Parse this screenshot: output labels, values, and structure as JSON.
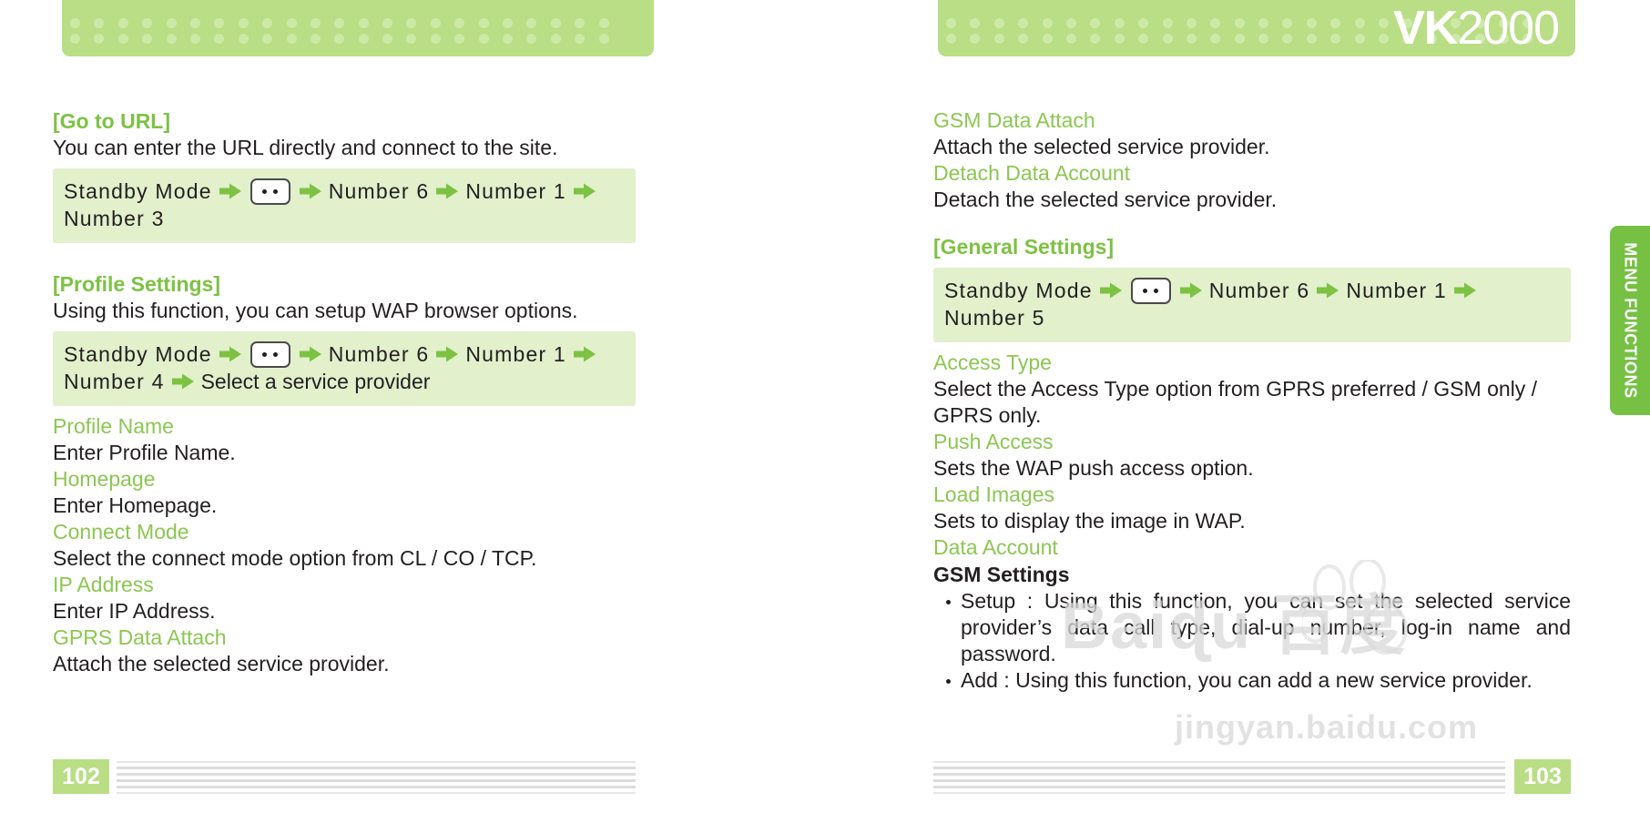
{
  "brand": {
    "prefix": "VK",
    "suffix": "2000"
  },
  "side_tab": {
    "label": "MENU FUNCTIONS"
  },
  "colors": {
    "accent_green": "#7dc243",
    "band_green": "#b9de85",
    "path_box_green": "#e2f0cc",
    "tab_green": "#76c043",
    "text_black": "#231f20"
  },
  "left_page": {
    "page_number": "102",
    "sections": [
      {
        "title": "[Go to URL]",
        "description": "You can enter the URL directly and connect to the site.",
        "path": {
          "line1": [
            "Standby Mode",
            "menu-key-icon",
            "Number 6",
            "Number 1"
          ],
          "line2": [
            "Number 3"
          ]
        }
      },
      {
        "title": "[Profile Settings]",
        "description": "Using this function, you can setup WAP browser options.",
        "path": {
          "line1": [
            "Standby Mode",
            "menu-key-icon",
            "Number 6",
            "Number 1"
          ],
          "line2": [
            "Number 4",
            "Select a service provider"
          ]
        },
        "items": [
          {
            "name": "Profile Name",
            "text": "Enter Profile Name."
          },
          {
            "name": "Homepage",
            "text": "Enter Homepage."
          },
          {
            "name": "Connect Mode",
            "text": "Select the connect mode option from CL / CO / TCP."
          },
          {
            "name": "IP Address",
            "text": "Enter IP Address."
          },
          {
            "name": "GPRS Data Attach",
            "text": "Attach the selected service provider."
          }
        ]
      }
    ]
  },
  "right_page": {
    "page_number": "103",
    "top_items": [
      {
        "name": "GSM Data Attach",
        "text": "Attach the selected service provider."
      },
      {
        "name": "Detach Data Account",
        "text": "Detach the selected service provider."
      }
    ],
    "general_settings": {
      "title": "[General Settings]",
      "path": {
        "line1": [
          "Standby Mode",
          "menu-key-icon",
          "Number 6",
          "Number 1"
        ],
        "line2": [
          "Number 5"
        ]
      },
      "items": [
        {
          "name": "Access Type",
          "text": "Select the Access Type option from GPRS preferred / GSM only / GPRS only."
        },
        {
          "name": "Push Access",
          "text": "Sets the WAP push access option."
        },
        {
          "name": "Load Images",
          "text": "Sets to display the image in WAP."
        },
        {
          "name": "Data Account",
          "text": ""
        }
      ],
      "gsm_settings": {
        "title": "GSM Settings",
        "bullets": [
          "Setup : Using this function, you can set the selected service provider’s data call type, dial-up number, log-in name and password.",
          "Add : Using this function, you can add a new service provider."
        ]
      }
    }
  },
  "watermark": {
    "main": "Baiɖu 百度",
    "sub": "jingyan.baidu.com"
  }
}
